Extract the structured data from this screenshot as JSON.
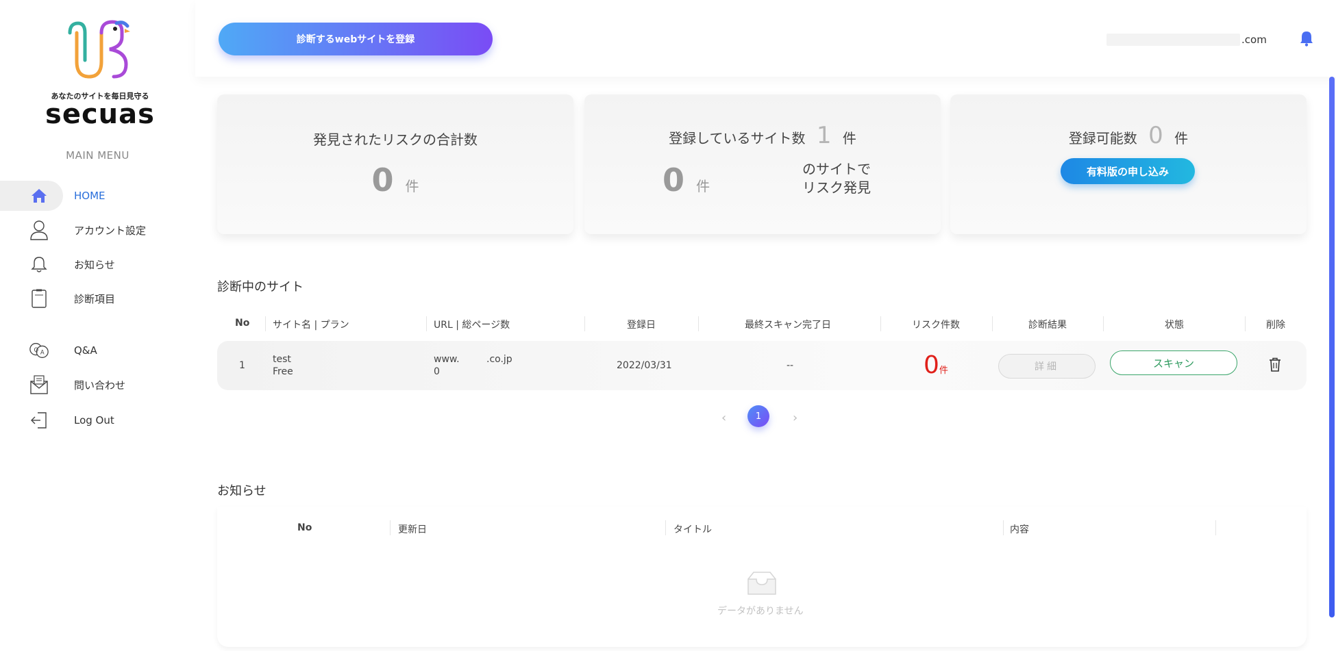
{
  "brand": {
    "tagline": "あなたのサイトを毎日見守る",
    "name": "secuas"
  },
  "sidebar": {
    "menu_title": "MAIN MENU",
    "items": [
      {
        "label": "HOME",
        "icon": "home-icon"
      },
      {
        "label": "アカウント設定",
        "icon": "user-icon"
      },
      {
        "label": "お知らせ",
        "icon": "bell-icon"
      },
      {
        "label": "診断項目",
        "icon": "clipboard-icon"
      },
      {
        "label": "Q&A",
        "icon": "qa-icon"
      },
      {
        "label": "問い合わせ",
        "icon": "mail-icon"
      },
      {
        "label": "Log Out",
        "icon": "logout-icon"
      }
    ]
  },
  "header": {
    "register_button": "診断するwebサイトを登録",
    "user_domain_suffix": ".com"
  },
  "stats": {
    "risk_total": {
      "title": "発見されたリスクの合計数",
      "value": "0",
      "unit": "件"
    },
    "registered": {
      "title_prefix": "登録しているサイト数",
      "count": "1",
      "unit": "件",
      "risk_sites": "0",
      "risk_sites_unit": "件",
      "risk_sites_line1": "のサイトで",
      "risk_sites_line2": "リスク発見"
    },
    "available": {
      "title_prefix": "登録可能数",
      "count": "0",
      "unit": "件",
      "upgrade_button": "有料版の申し込み"
    }
  },
  "sites": {
    "title": "診断中のサイト",
    "columns": [
      "No",
      "サイト名 | プラン",
      "URL | 総ページ数",
      "登録日",
      "最終スキャン完了日",
      "リスク件数",
      "診断結果",
      "状態",
      "削除"
    ],
    "rows": [
      {
        "no": "1",
        "name": "test",
        "plan": "Free",
        "url_prefix": "www.",
        "url_suffix": ".co.jp",
        "pages": "0",
        "registered": "2022/03/31",
        "last_scan": "--",
        "risk_count": "0",
        "risk_unit": "件",
        "detail_button": "詳細",
        "scan_button": "スキャン"
      }
    ],
    "pagination": {
      "prev": "‹",
      "current": "1",
      "next": "›"
    }
  },
  "news": {
    "title": "お知らせ",
    "columns": [
      "No",
      "更新日",
      "タイトル",
      "内容"
    ],
    "empty_text": "データがありません"
  },
  "colors": {
    "accent_blue": "#2a6fdb",
    "gradient_start": "#4fa9f6",
    "gradient_end": "#7a4cf5",
    "risk_red": "#e0201a",
    "scan_green": "#2e9a5e"
  }
}
